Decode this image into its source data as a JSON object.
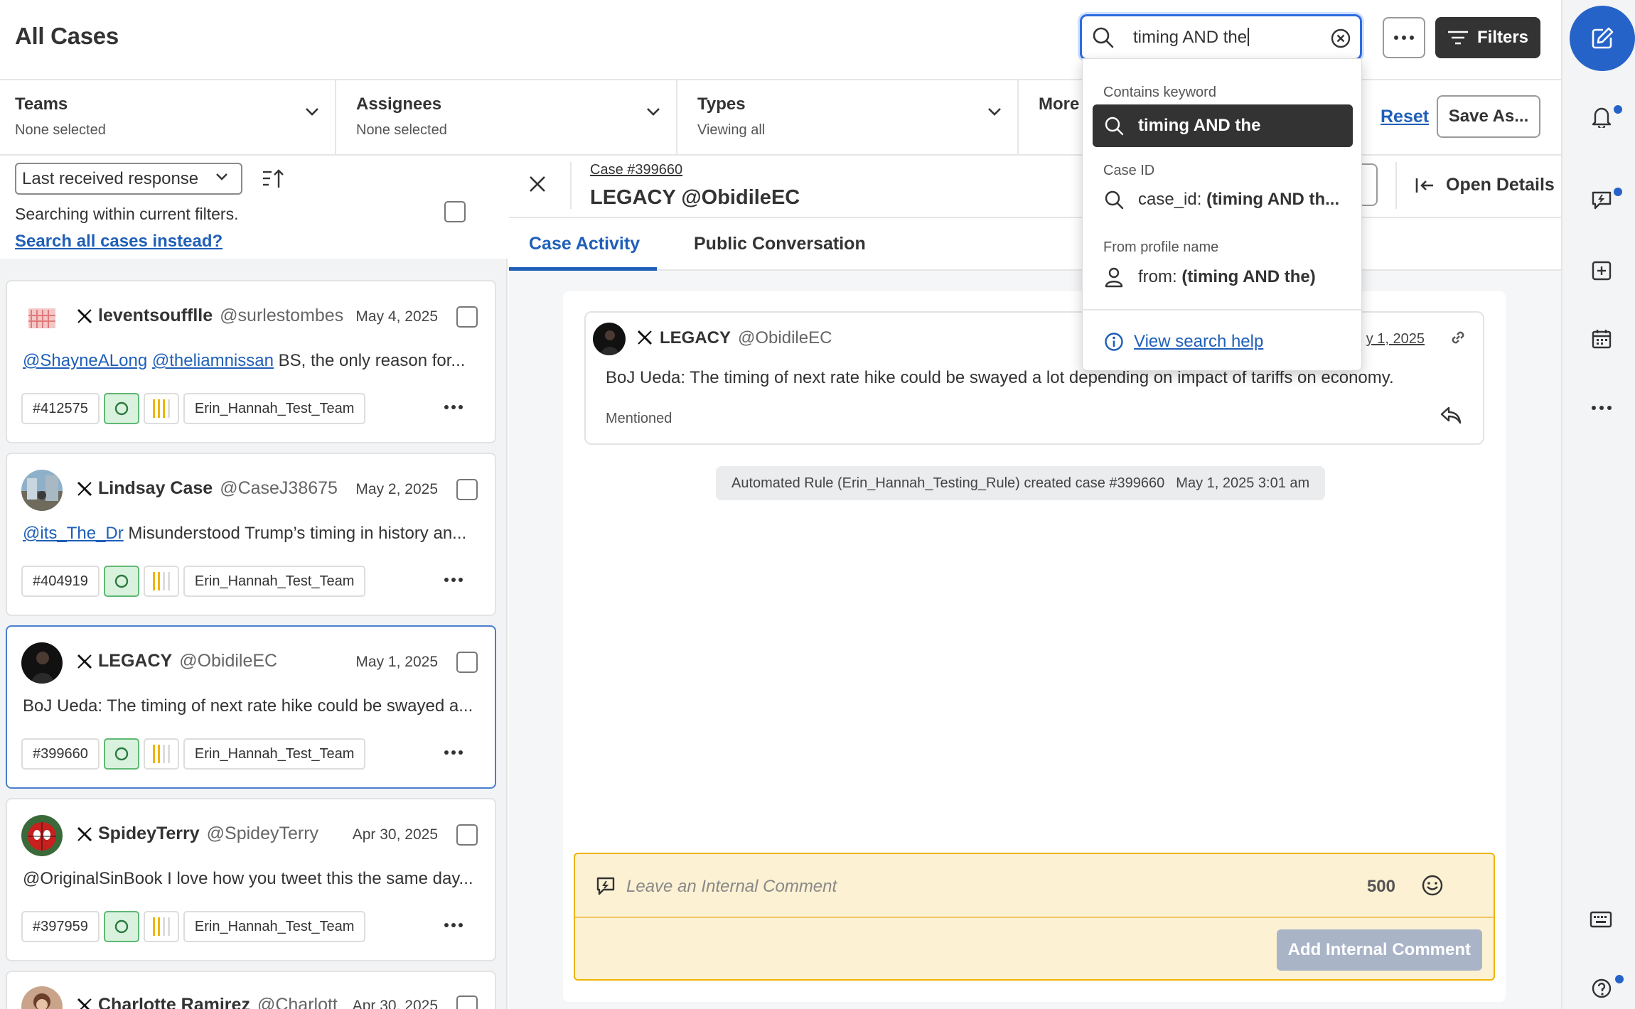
{
  "header": {
    "title": "All Cases",
    "search_value": "timing AND the",
    "filters_label": "Filters"
  },
  "filters": [
    {
      "title": "Teams",
      "sub": "None selected"
    },
    {
      "title": "Assignees",
      "sub": "None selected"
    },
    {
      "title": "Types",
      "sub": "Viewing all"
    },
    {
      "title": "More",
      "sub": ""
    }
  ],
  "filter_actions": {
    "reset": "Reset",
    "save_as": "Save As..."
  },
  "list": {
    "sort_label": "Last received response",
    "searching_within": "Searching within current filters.",
    "search_all": "Search all cases instead?",
    "cases": [
      {
        "name": "leventsoufflle",
        "handle": "@surlestombes",
        "date": "May 4, 2025",
        "mentions": [
          "@ShayneALong",
          "@theliamnissan"
        ],
        "text": " BS, the only reason for...",
        "id": "#412575",
        "team": "Erin_Hannah_Test_Team"
      },
      {
        "name": "Lindsay Case",
        "handle": "@CaseJ38675",
        "date": "May 2, 2025",
        "mentions": [
          "@its_The_Dr"
        ],
        "text": " Misunderstood Trump’s timing in history an...",
        "id": "#404919",
        "team": "Erin_Hannah_Test_Team"
      },
      {
        "name": "LEGACY",
        "handle": "@ObidileEC",
        "date": "May 1, 2025",
        "mentions": [],
        "text": "BoJ Ueda: The timing of next rate hike could be swayed a...",
        "id": "#399660",
        "team": "Erin_Hannah_Test_Team"
      },
      {
        "name": "SpideyTerry",
        "handle": "@SpideyTerry",
        "date": "Apr 30, 2025",
        "mentions": [],
        "text": "@OriginalSinBook I love how you tweet this the same day...",
        "id": "#397959",
        "team": "Erin_Hannah_Test_Team"
      },
      {
        "name": "Charlotte Ramirez",
        "handle": "@Charlott",
        "date": "Apr 30, 2025",
        "mentions": [],
        "text": "",
        "id": "",
        "team": ""
      }
    ]
  },
  "case_view": {
    "case_link": "Case #399660",
    "title": "LEGACY @ObidileEC",
    "open_details": "Open Details",
    "tabs": [
      "Case Activity",
      "Public Conversation"
    ],
    "message": {
      "name": "LEGACY",
      "handle": "@ObidileEC",
      "date": "y 1, 2025",
      "body": "BoJ Ueda: The timing of next rate hike could be swayed a lot depending on impact of tariffs on economy.",
      "label": "Mentioned"
    },
    "automated_rule": "Automated Rule (Erin_Hannah_Testing_Rule) created case #399660",
    "automated_rule_time": "May 1, 2025 3:01 am",
    "comment_placeholder": "Leave an Internal Comment",
    "comment_count": "500",
    "add_comment": "Add Internal Comment"
  },
  "dropdown": {
    "section_keyword": "Contains keyword",
    "keyword_value": "timing AND the",
    "section_caseid": "Case ID",
    "caseid_prefix": "case_id:",
    "caseid_value": "(timing AND th...",
    "section_profile": "From profile name",
    "profile_prefix": "from:",
    "profile_value": "(timing AND the)",
    "help": "View search help"
  },
  "colors": {
    "accent": "#2563c9",
    "link": "#1f5fb8",
    "status_green": "#5fb873",
    "priority_yellow": "#f0b400",
    "comment_bg": "#fdf1d4"
  }
}
